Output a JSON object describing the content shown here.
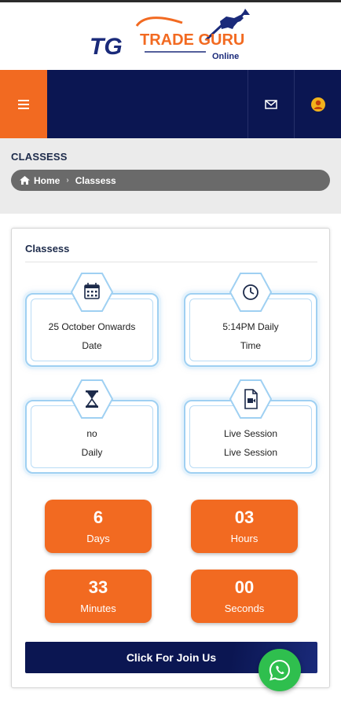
{
  "header": {
    "logo_initials": "TG",
    "logo_name": "TRADE GURU",
    "logo_sub": "Online"
  },
  "nav": {
    "menu_icon": "hamburger-icon",
    "mail_icon": "envelope-icon",
    "user_icon": "user-avatar-icon"
  },
  "breadcrumb": {
    "title": "CLASSESS",
    "home": "Home",
    "separator": "›",
    "current": "Classess"
  },
  "card": {
    "title": "Classess",
    "info": [
      {
        "icon": "calendar-icon",
        "line1": "25 October Onwards",
        "line2": "Date"
      },
      {
        "icon": "clock-icon",
        "line1": "5:14PM Daily",
        "line2": "Time"
      },
      {
        "icon": "hourglass-icon",
        "line1": "no",
        "line2": "Daily"
      },
      {
        "icon": "video-file-icon",
        "line1": "Live Session",
        "line2": "Live Session"
      }
    ],
    "countdown": [
      {
        "value": "6",
        "label": "Days"
      },
      {
        "value": "03",
        "label": "Hours"
      },
      {
        "value": "33",
        "label": "Minutes"
      },
      {
        "value": "00",
        "label": "Seconds"
      }
    ],
    "join_label": "Click For Join Us"
  },
  "floating": {
    "whatsapp_icon": "whatsapp-icon"
  },
  "colors": {
    "accent_orange": "#f26a21",
    "navy": "#0b1652",
    "info_border": "#9fd0f2",
    "whatsapp_green": "#2fbf4e"
  }
}
